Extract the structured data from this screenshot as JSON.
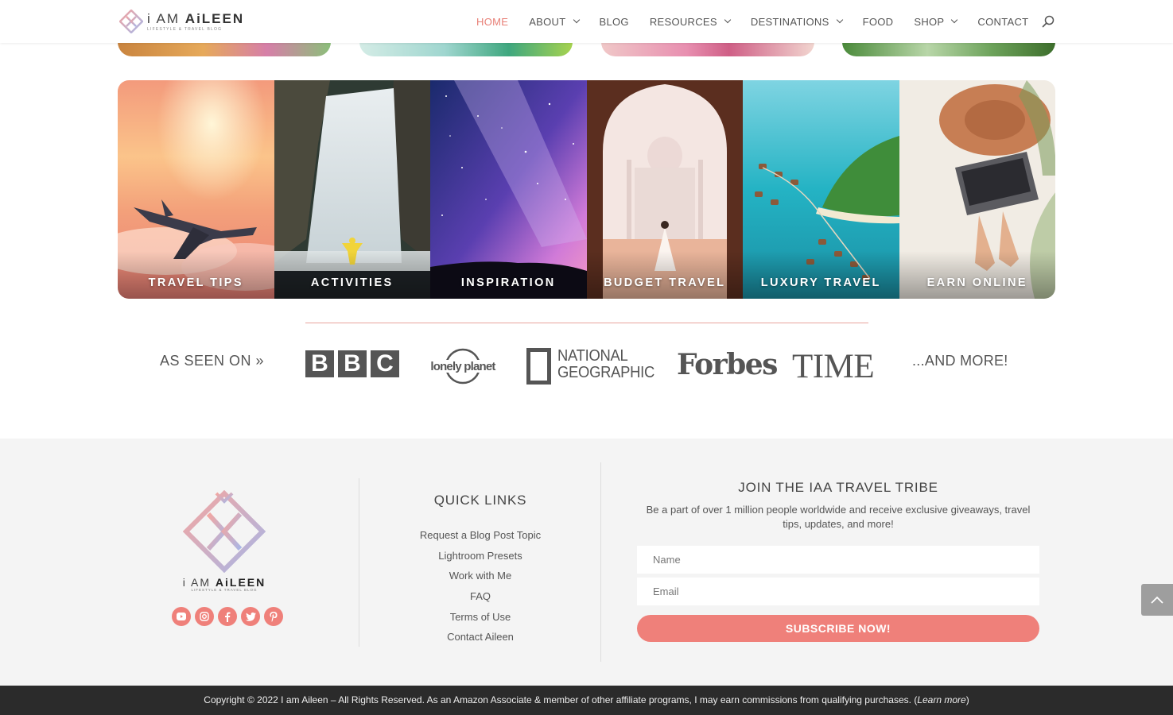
{
  "header": {
    "logo_prefix": "i AM",
    "logo_name": "AiLEEN",
    "logo_tagline": "LIFESTYLE & TRAVEL BLOG",
    "nav": [
      {
        "label": "HOME",
        "active": true,
        "dropdown": false
      },
      {
        "label": "ABOUT",
        "active": false,
        "dropdown": true
      },
      {
        "label": "BLOG",
        "active": false,
        "dropdown": false
      },
      {
        "label": "RESOURCES",
        "active": false,
        "dropdown": true
      },
      {
        "label": "DESTINATIONS",
        "active": false,
        "dropdown": true
      },
      {
        "label": "FOOD",
        "active": false,
        "dropdown": false
      },
      {
        "label": "SHOP",
        "active": false,
        "dropdown": true
      },
      {
        "label": "CONTACT",
        "active": false,
        "dropdown": false
      }
    ],
    "search_icon": "search-icon"
  },
  "categories": [
    {
      "label": "TRAVEL TIPS"
    },
    {
      "label": "ACTIVITIES"
    },
    {
      "label": "INSPIRATION"
    },
    {
      "label": "BUDGET TRAVEL"
    },
    {
      "label": "LUXURY TRAVEL"
    },
    {
      "label": "EARN ONLINE"
    }
  ],
  "press": {
    "label": "AS SEEN ON »",
    "logos": {
      "bbc": [
        "B",
        "B",
        "C"
      ],
      "lonely_planet": "lonely planet",
      "natgeo_line1": "NATIONAL",
      "natgeo_line2": "GEOGRAPHIC",
      "forbes": "Forbes",
      "time": "TIME"
    },
    "more": "...AND MORE!"
  },
  "footer": {
    "logo_prefix": "i AM",
    "logo_name": "AiLEEN",
    "logo_tagline": "LIFESTYLE & TRAVEL BLOG",
    "socials": [
      "youtube-icon",
      "instagram-icon",
      "facebook-icon",
      "twitter-icon",
      "pinterest-icon"
    ],
    "quick_links_title": "QUICK LINKS",
    "quick_links": [
      "Request a Blog Post Topic",
      "Lightroom Presets",
      "Work with Me",
      "FAQ",
      "Terms of Use",
      "Contact Aileen"
    ],
    "tribe_title": "JOIN THE IAA TRAVEL TRIBE",
    "tribe_desc_line1": "Be a part of over 1 million people worldwide and receive exclusive giveaways, travel",
    "tribe_desc_line2": "tips, updates, and more!",
    "name_placeholder": "Name",
    "email_placeholder": "Email",
    "subscribe_label": "SUBSCRIBE NOW!"
  },
  "copyright": {
    "text": "Copyright © 2022 I am Aileen – All Rights Reserved. As an Amazon Associate & member of other affiliate programs, I may earn commissions from qualifying purchases. (",
    "link": "Learn more",
    "close": ")"
  },
  "colors": {
    "accent": "#ef807a",
    "nav_active": "#e87f76",
    "footer_bg": "#f4f4f4",
    "bottom_bar": "#2b2b2b"
  }
}
